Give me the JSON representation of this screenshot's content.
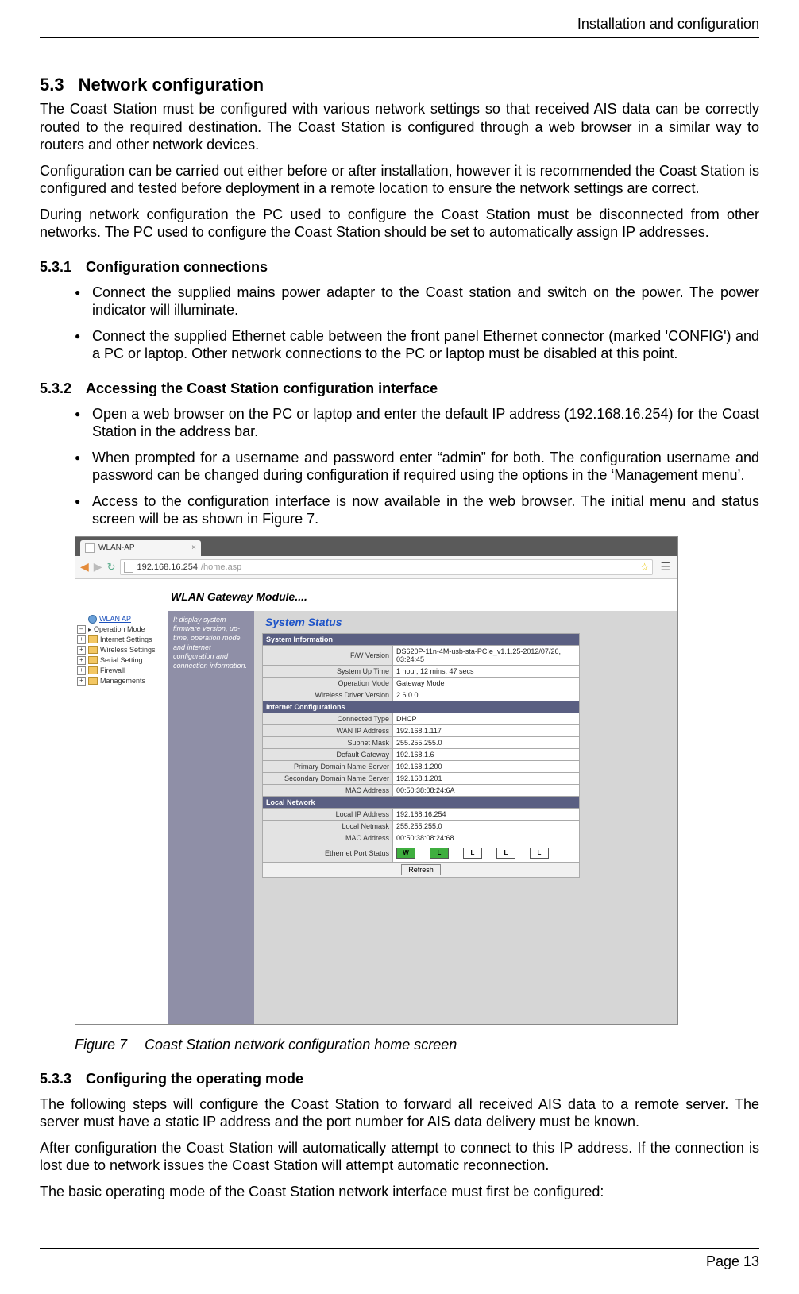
{
  "running_head": "Installation and configuration",
  "section": {
    "num": "5.3",
    "title": "Network configuration"
  },
  "para1": "The Coast Station must be configured with various network settings so that received AIS data can be correctly routed to the required destination. The Coast Station is configured through a web browser in a similar way to routers and other network devices.",
  "para2": "Configuration can be carried out either before or after installation, however it is recommended the Coast Station is configured and tested before deployment in a remote location to ensure the network settings are correct.",
  "para3": "During network configuration the PC used to configure the Coast Station must be disconnected from other networks. The PC used to configure the Coast Station should be set to automatically assign IP addresses.",
  "sub531": {
    "num": "5.3.1",
    "title": "Configuration connections"
  },
  "b531": [
    "Connect the supplied mains power adapter to the Coast station and switch on the power. The power indicator will illuminate.",
    "Connect the supplied Ethernet cable between the front panel Ethernet connector (marked 'CONFIG') and a PC or laptop. Other network connections to the PC or laptop must be disabled at this point."
  ],
  "sub532": {
    "num": "5.3.2",
    "title": "Accessing the Coast Station configuration interface"
  },
  "b532": [
    "Open a web browser on the PC or laptop and enter the default IP address (192.168.16.254) for the Coast Station in the address bar.",
    "When prompted for a username and password enter “admin” for both. The configuration username and password can be changed during configuration if required using the options in the ‘Management menu’.",
    "Access to the configuration interface is now available in the web browser. The initial menu and status screen will be as shown in Figure 7."
  ],
  "browser": {
    "tab_title": "WLAN-AP",
    "url_host": "192.168.16.254",
    "url_path": "/home.asp"
  },
  "banner": "WLAN Gateway Module....",
  "tree": {
    "root": "WLAN AP",
    "items": [
      "Operation Mode",
      "Internet Settings",
      "Wireless Settings",
      "Serial Setting",
      "Firewall",
      "Managements"
    ]
  },
  "hint": "It display system firmware version, up-time, operation mode and internet configuration and connection information.",
  "content_title": "System Status",
  "sections": {
    "sysinfo": {
      "header": "System Information",
      "rows": [
        {
          "label": "F/W Version",
          "value": "DS620P-11n-4M-usb-sta-PCIe_v1.1.25-2012/07/26, 03:24:45"
        },
        {
          "label": "System Up Time",
          "value": "1 hour, 12 mins, 47 secs"
        },
        {
          "label": "Operation Mode",
          "value": "Gateway Mode"
        },
        {
          "label": "Wireless Driver Version",
          "value": "2.6.0.0"
        }
      ]
    },
    "inet": {
      "header": "Internet Configurations",
      "rows": [
        {
          "label": "Connected Type",
          "value": "DHCP"
        },
        {
          "label": "WAN IP Address",
          "value": "192.168.1.117"
        },
        {
          "label": "Subnet Mask",
          "value": "255.255.255.0"
        },
        {
          "label": "Default Gateway",
          "value": "192.168.1.6"
        },
        {
          "label": "Primary Domain Name Server",
          "value": "192.168.1.200"
        },
        {
          "label": "Secondary Domain Name Server",
          "value": "192.168.1.201"
        },
        {
          "label": "MAC Address",
          "value": "00:50:38:08:24:6A"
        }
      ]
    },
    "local": {
      "header": "Local Network",
      "rows": [
        {
          "label": "Local IP Address",
          "value": "192.168.16.254"
        },
        {
          "label": "Local Netmask",
          "value": "255.255.255.0"
        },
        {
          "label": "MAC Address",
          "value": "00:50:38:08:24:68"
        }
      ],
      "port_label": "Ethernet Port Status",
      "ports": [
        {
          "tag": "W",
          "on": true
        },
        {
          "tag": "L",
          "on": true
        },
        {
          "tag": "L",
          "on": false
        },
        {
          "tag": "L",
          "on": false
        },
        {
          "tag": "L",
          "on": false
        }
      ],
      "refresh": "Refresh"
    }
  },
  "figure": {
    "num": "Figure 7",
    "caption": "Coast Station network configuration home screen"
  },
  "sub533": {
    "num": "5.3.3",
    "title": "Configuring the operating mode"
  },
  "para4": "The following steps will configure the Coast Station to forward all received AIS data to a remote server. The server must have a static IP address and the port number for AIS data delivery must be known.",
  "para5": "After configuration the Coast Station will automatically attempt to connect to this IP address. If the connection is lost due to network issues the Coast Station will attempt automatic reconnection.",
  "para6": "The basic operating mode of the Coast Station network interface must first be configured:",
  "footer": "Page 13"
}
